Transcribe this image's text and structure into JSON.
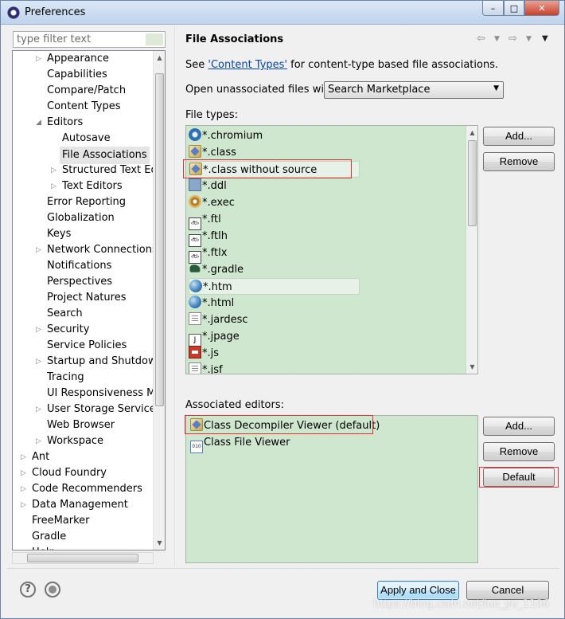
{
  "window": {
    "title": "Preferences"
  },
  "filter": {
    "placeholder": "type filter text"
  },
  "tree": {
    "items": [
      {
        "label": "Appearance",
        "twisty": "▷"
      },
      {
        "label": "Capabilities",
        "twisty": ""
      },
      {
        "label": "Compare/Patch",
        "twisty": ""
      },
      {
        "label": "Content Types",
        "twisty": ""
      },
      {
        "label": "Editors",
        "twisty": "◢"
      },
      {
        "label": "Autosave",
        "twisty": ""
      },
      {
        "label": "File Associations",
        "twisty": ""
      },
      {
        "label": "Structured Text Edit",
        "twisty": "▷"
      },
      {
        "label": "Text Editors",
        "twisty": "▷"
      },
      {
        "label": "Error Reporting",
        "twisty": ""
      },
      {
        "label": "Globalization",
        "twisty": ""
      },
      {
        "label": "Keys",
        "twisty": ""
      },
      {
        "label": "Network Connections",
        "twisty": "▷"
      },
      {
        "label": "Notifications",
        "twisty": ""
      },
      {
        "label": "Perspectives",
        "twisty": ""
      },
      {
        "label": "Project Natures",
        "twisty": ""
      },
      {
        "label": "Search",
        "twisty": ""
      },
      {
        "label": "Security",
        "twisty": "▷"
      },
      {
        "label": "Service Policies",
        "twisty": ""
      },
      {
        "label": "Startup and Shutdown",
        "twisty": "▷"
      },
      {
        "label": "Tracing",
        "twisty": ""
      },
      {
        "label": "UI Responsiveness Mo",
        "twisty": ""
      },
      {
        "label": "User Storage Service",
        "twisty": "▷"
      },
      {
        "label": "Web Browser",
        "twisty": ""
      },
      {
        "label": "Workspace",
        "twisty": "▷"
      },
      {
        "label": "Ant",
        "twisty": "▷"
      },
      {
        "label": "Cloud Foundry",
        "twisty": "▷"
      },
      {
        "label": "Code Recommenders",
        "twisty": "▷"
      },
      {
        "label": "Data Management",
        "twisty": "▷"
      },
      {
        "label": "FreeMarker",
        "twisty": ""
      },
      {
        "label": "Gradle",
        "twisty": ""
      },
      {
        "label": "Help",
        "twisty": "▷"
      }
    ]
  },
  "page": {
    "title": "File Associations",
    "see_prefix": "See ",
    "see_link": "'Content Types'",
    "see_suffix": " for content-type based file associations.",
    "open_label": "Open unassociated files with:",
    "open_value": "Search Marketplace",
    "file_types_label": "File types:",
    "file_types": [
      {
        "label": "*.chromium",
        "icon": "chromium"
      },
      {
        "label": "*.class",
        "icon": "classf"
      },
      {
        "label": "*.class without source",
        "icon": "classf"
      },
      {
        "label": "*.ddl",
        "icon": "ddl"
      },
      {
        "label": "*.exec",
        "icon": "gear"
      },
      {
        "label": "*.ftl",
        "icon": "ftl"
      },
      {
        "label": "*.ftlh",
        "icon": "ftl"
      },
      {
        "label": "*.ftlx",
        "icon": "ftl"
      },
      {
        "label": "*.gradle",
        "icon": "gradle"
      },
      {
        "label": "*.htm",
        "icon": "globe"
      },
      {
        "label": "*.html",
        "icon": "globe"
      },
      {
        "label": "*.jardesc",
        "icon": "doc"
      },
      {
        "label": "*.jpage",
        "icon": "jpage"
      },
      {
        "label": "*.js",
        "icon": "js"
      },
      {
        "label": "*.jsf",
        "icon": "doc"
      }
    ],
    "assoc_label": "Associated editors:",
    "editors": [
      {
        "label": "Class Decompiler Viewer (default)",
        "icon": "classf"
      },
      {
        "label": "Class File Viewer",
        "icon": "bin"
      }
    ],
    "buttons": {
      "add1": "Add...",
      "remove1": "Remove",
      "add2": "Add...",
      "remove2": "Remove",
      "default": "Default"
    }
  },
  "footer": {
    "apply_close": "Apply and Close",
    "cancel": "Cancel"
  },
  "watermark": "https://blog.csdn.net/luo_yu_1106"
}
